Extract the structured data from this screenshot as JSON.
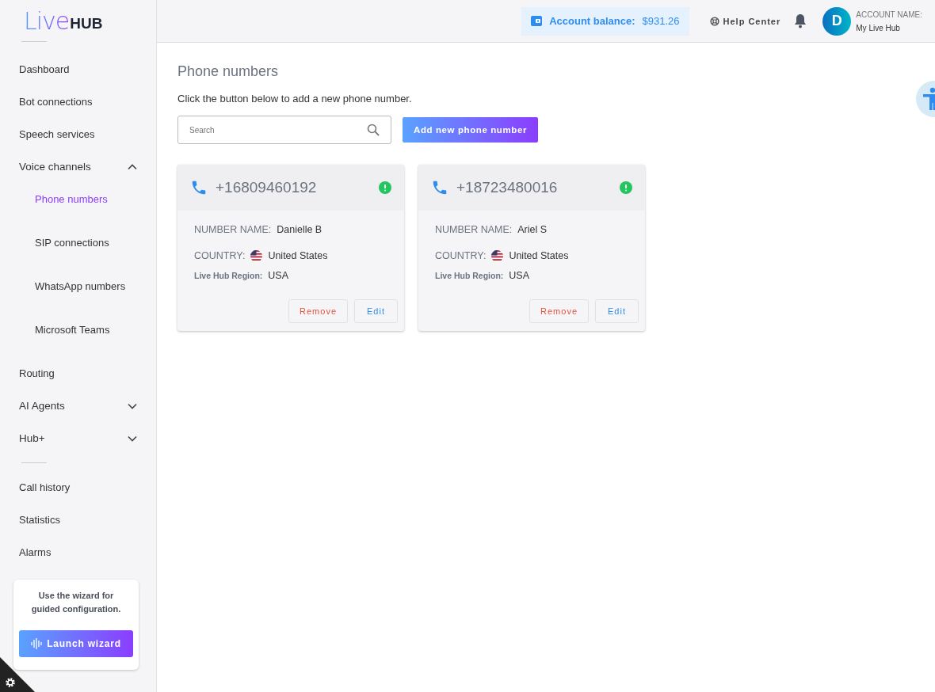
{
  "logo": {
    "part_1": "Live",
    "part_2": "HUB"
  },
  "header": {
    "balance_label": "Account balance:",
    "balance_value": "$931.26",
    "help": "Help Center",
    "avatar_letter": "D",
    "account_label": "ACCOUNT NAME:",
    "account_name": "My Live Hub"
  },
  "sidebar": {
    "items": [
      {
        "kind": "link",
        "label": "Dashboard",
        "selected": false
      },
      {
        "kind": "link",
        "label": "Bot connections",
        "selected": false
      },
      {
        "kind": "link",
        "label": "Speech services",
        "selected": false
      },
      {
        "kind": "group",
        "label": "Voice channels",
        "expanded": true,
        "children": [
          {
            "label": "Phone numbers",
            "selected": true
          },
          {
            "label": "SIP connections",
            "selected": false
          },
          {
            "label": "WhatsApp numbers",
            "selected": false
          },
          {
            "label": "Microsoft Teams",
            "selected": false
          }
        ]
      },
      {
        "kind": "link",
        "label": "Routing",
        "selected": false
      },
      {
        "kind": "group",
        "label": "AI Agents",
        "expanded": false
      },
      {
        "kind": "group",
        "label": "Hub+",
        "expanded": false
      },
      {
        "kind": "divider"
      },
      {
        "kind": "link",
        "label": "Call history",
        "selected": false
      },
      {
        "kind": "link",
        "label": "Statistics",
        "selected": false
      },
      {
        "kind": "link",
        "label": "Alarms",
        "selected": false
      }
    ],
    "wizard": {
      "text": "Use the wizard for guided configuration.",
      "button": "Launch wizard"
    }
  },
  "page": {
    "title": "Phone numbers",
    "subtitle": "Click the button below to add a new phone number.",
    "search": {
      "placeholder": "Search"
    },
    "add_button": "Add new phone number"
  },
  "cards": [
    {
      "number": "+16809460192",
      "name_label": "NUMBER NAME:",
      "name": "Danielle B",
      "country_label": "COUNTRY:",
      "country": "United States",
      "region_label": "Live Hub Region:",
      "region": "USA",
      "remove": "Remove",
      "edit": "Edit"
    },
    {
      "number": "+18723480016",
      "name_label": "NUMBER NAME:",
      "name": "Ariel S",
      "country_label": "COUNTRY:",
      "country": "United States",
      "region_label": "Live Hub Region:",
      "region": "USA",
      "remove": "Remove",
      "edit": "Edit"
    }
  ]
}
